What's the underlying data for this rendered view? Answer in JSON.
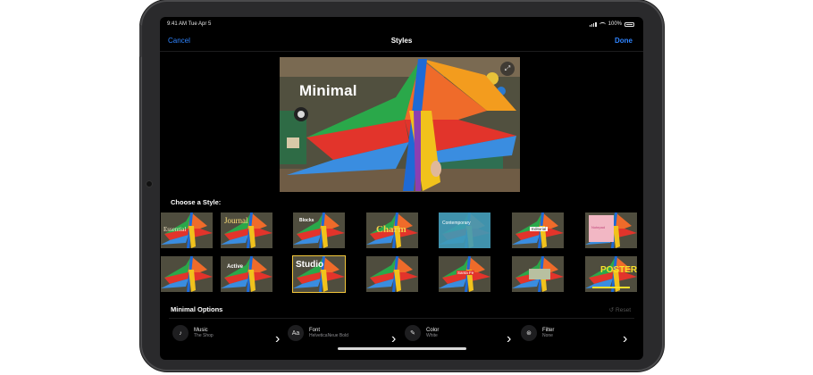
{
  "status": {
    "time": "9:41 AM  Tue Apr 5",
    "battery": "100%"
  },
  "nav": {
    "cancel": "Cancel",
    "title": "Styles",
    "done": "Done"
  },
  "preview": {
    "title": "Minimal"
  },
  "styles": {
    "heading": "Choose a Style:",
    "row1": [
      "Essential",
      "Journal",
      "Blocks",
      "Charm",
      "Contemporary",
      "Editorial",
      "Notepad"
    ],
    "row2": [
      "",
      "Active",
      "Studio",
      "",
      "Santa Fe",
      "",
      "POSTER"
    ],
    "selected_index": 9
  },
  "options": {
    "heading": "Minimal Options",
    "reset": "Reset",
    "items": [
      {
        "icon": "music-note-icon",
        "title": "Music",
        "value": "The Shop"
      },
      {
        "icon": "font-icon",
        "glyph": "Aa",
        "title": "Font",
        "value": "HelveticaNeue Bold"
      },
      {
        "icon": "eyedropper-icon",
        "title": "Color",
        "value": "White"
      },
      {
        "icon": "filter-icon",
        "title": "Filter",
        "value": "None"
      }
    ]
  },
  "colors": {
    "accent": "#2f84ff",
    "selected_outline": "#f3c73b"
  }
}
